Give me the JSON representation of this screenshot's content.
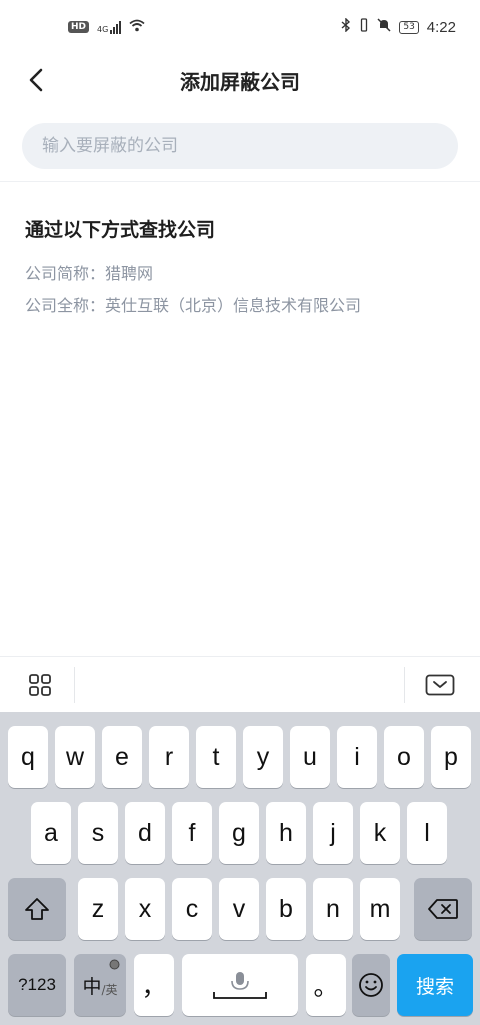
{
  "status_bar": {
    "network": "HD",
    "signal_type": "4G",
    "battery": "53",
    "time": "4:22"
  },
  "nav": {
    "title": "添加屏蔽公司",
    "back_icon": "chevron-left-icon"
  },
  "search": {
    "placeholder": "输入要屏蔽的公司",
    "value": ""
  },
  "hint": {
    "title": "通过以下方式查找公司",
    "short_name_line": "公司简称：猎聘网",
    "full_name_line": "公司全称：英仕互联（北京）信息技术有限公司"
  },
  "keyboard": {
    "row1": [
      "q",
      "w",
      "e",
      "r",
      "t",
      "y",
      "u",
      "i",
      "o",
      "p"
    ],
    "row2": [
      "a",
      "s",
      "d",
      "f",
      "g",
      "h",
      "j",
      "k",
      "l"
    ],
    "row3": [
      "z",
      "x",
      "c",
      "v",
      "b",
      "n",
      "m"
    ],
    "num_key": "?123",
    "lang_key_main": "中",
    "lang_key_sub": "/英",
    "comma_key": "，",
    "period_key": "。",
    "search_key": "搜索",
    "colors": {
      "background": "#d2d5db",
      "key": "#ffffff",
      "dark_key": "#aeb3bd",
      "action": "#1aa3f0"
    }
  }
}
